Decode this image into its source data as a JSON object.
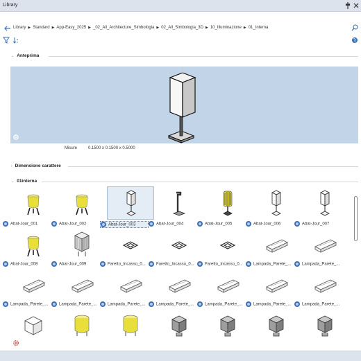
{
  "window": {
    "title": "Library",
    "pin_icon": "pin-icon",
    "close_icon": "close-icon"
  },
  "breadcrumb": {
    "items": [
      "Library",
      "Standard",
      "App-Easy_2025",
      "_02_All_Architecture_Simbologia",
      "02_All_Simbologia_3D",
      "10_Illuminazione",
      "01_Interna"
    ]
  },
  "toolbar": {
    "filter_icon": "filter-icon",
    "sort_icon": "sort-icon",
    "globe_icon": "globe-icon"
  },
  "anteprima": {
    "label": "Anteprima",
    "background": "#c1d4e8"
  },
  "misure": {
    "label": "Misure",
    "value": "0.1500 x 0.1500 x 0.5000"
  },
  "dimensione": {
    "label": "Dimensione carattere"
  },
  "group": {
    "label": "01interna"
  },
  "items": [
    {
      "label": "Abat-Jour_001",
      "icon": "lamp-yellow-icon"
    },
    {
      "label": "Abat-Jour_002",
      "icon": "lamp-yellow-icon"
    },
    {
      "label": "Abat-Jour_003",
      "icon": "lamp-white-icon",
      "selected": true
    },
    {
      "label": "Abat-Jour_004",
      "icon": "arc-lamp-icon"
    },
    {
      "label": "Abat-Jour_005",
      "icon": "lamp-striped-icon"
    },
    {
      "label": "Abat-Jour_006",
      "icon": "lamp-white-icon"
    },
    {
      "label": "Abat-Jour_007",
      "icon": "lamp-white-icon"
    },
    {
      "label": "Abat-Jour_008",
      "icon": "lamp-yellow-icon"
    },
    {
      "label": "Abat-Jour_009",
      "icon": "lamp-grey-icon"
    },
    {
      "label": "Faretto_Incasso_0...",
      "icon": "recessed-spot-icon"
    },
    {
      "label": "Faretto_Incasso_0...",
      "icon": "recessed-spot-icon"
    },
    {
      "label": "Faretto_Incasso_0...",
      "icon": "recessed-spot-icon"
    },
    {
      "label": "Lampada_Parete_...",
      "icon": "wall-lamp-icon"
    },
    {
      "label": "Lampada_Parete_...",
      "icon": "wall-lamp-icon"
    },
    {
      "label": "Lampada_Parete_...",
      "icon": "wall-lamp-icon"
    },
    {
      "label": "Lampada_Parete_...",
      "icon": "wall-lamp-icon"
    },
    {
      "label": "Lampada_Parete_...",
      "icon": "wall-lamp-icon"
    },
    {
      "label": "Lampada_Parete_...",
      "icon": "wall-lamp-icon"
    },
    {
      "label": "Lampada_Parete_...",
      "icon": "wall-lamp-icon"
    },
    {
      "label": "Lampada_Parete_...",
      "icon": "wall-lamp-icon"
    },
    {
      "label": "Lampada_Parete_...",
      "icon": "wall-lamp-icon"
    },
    {
      "label": "",
      "icon": "box-lamp-icon"
    },
    {
      "label": "",
      "icon": "drum-lamp-icon"
    },
    {
      "label": "",
      "icon": "drum-lamp-icon"
    },
    {
      "label": "",
      "icon": "cube-lamp-icon"
    },
    {
      "label": "",
      "icon": "cube-lamp-icon"
    },
    {
      "label": "",
      "icon": "cube-lamp-icon"
    },
    {
      "label": "",
      "icon": "cube-lamp-icon"
    }
  ],
  "colors": {
    "accent": "#3e6fb3",
    "lamp_yellow": "#e8df3a",
    "status_bar": "#dde3ec"
  },
  "bottom": {
    "icon": "settings-icon"
  }
}
